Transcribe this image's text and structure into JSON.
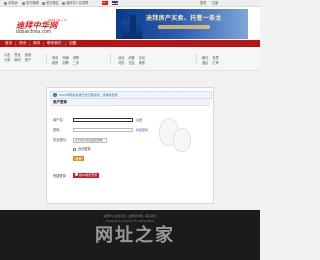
{
  "top_links": [
    "手机版",
    "官方微博",
    "官方微信",
    "迪拜华人交流群",
    "登录",
    "注册"
  ],
  "header": {
    "logo_cn": "迪拜中华网",
    "logo_tagline": "迪拜华人第一门户",
    "logo_en": "dubaichina.com",
    "banner_text": "迪拜房产买卖、托管一条龙"
  },
  "nav": {
    "items": [
      "首页",
      "资讯",
      "商讯",
      "联系我们",
      "加盟"
    ]
  },
  "subnav": {
    "group1": [
      "公告",
      "分类",
      "签证",
      "新闻",
      "旅游",
      "房产"
    ],
    "group2": [
      "黄页",
      "租房",
      "商铺",
      "招聘",
      "求职",
      "二手"
    ],
    "group3": [
      "活动",
      "问答",
      "闲置",
      "交友",
      "论坛",
      "美食"
    ],
    "group4": [
      "曝光",
      "酒店",
      "机票",
      "汇率"
    ]
  },
  "login": {
    "info_icon": "i",
    "info_text": "2022年网站系统已经迁移完成，请重新登录",
    "title": "用户登录",
    "username_label": "用户名：",
    "username_value": "",
    "register_link": "注册",
    "password_label": "密码：",
    "forgot_link": "找回密码",
    "security_label": "安全提问：",
    "security_select": "安全提问(未设置请忽略)",
    "auto_login_label": "自动登录",
    "submit_label": "登录",
    "quick_label": "快捷登录：",
    "qq_button": "用QQ帐号登录"
  },
  "footer": {
    "line1": "迪拜华人交流论坛 - 迪拜中华网 - 联系我们",
    "line2": "Powered by Discuz! © 2001-2022",
    "watermark": "网址之家"
  },
  "colors": {
    "nav_red": "#b81414",
    "accent_blue": "#2a5db0",
    "login_orange": "#e8a13a",
    "footer_dark": "#1b1b1b"
  }
}
